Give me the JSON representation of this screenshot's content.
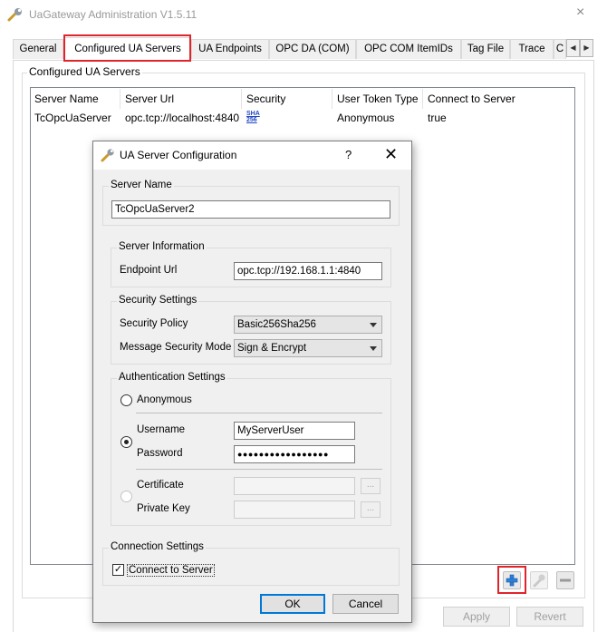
{
  "window": {
    "title": "UaGateway Administration V1.5.11",
    "close_glyph": "×",
    "icon": "wrench-icon"
  },
  "tabs": [
    {
      "label": "General"
    },
    {
      "label": "Configured UA Servers",
      "active": true
    },
    {
      "label": "UA Endpoints"
    },
    {
      "label": "OPC DA (COM)"
    },
    {
      "label": "OPC COM ItemIDs"
    },
    {
      "label": "Tag File"
    },
    {
      "label": "Trace"
    },
    {
      "label": "C"
    }
  ],
  "tab_scroll": {
    "left": "◀",
    "right": "▶"
  },
  "servers_panel": {
    "title": "Configured UA Servers",
    "columns": [
      "Server Name",
      "Server Url",
      "Security",
      "User Token Type",
      "Connect to Server"
    ],
    "rows": [
      {
        "server_name": "TcOpcUaServer",
        "server_url": "opc.tcp://localhost:4840",
        "security_icon_text": "SHA 256",
        "user_token_type": "Anonymous",
        "connect": "true"
      }
    ],
    "toolbar": {
      "add": "add-icon",
      "edit": "wrench-icon",
      "remove": "remove-icon"
    }
  },
  "footer": {
    "apply": "Apply",
    "revert": "Revert"
  },
  "dialog": {
    "title": "UA Server Configuration",
    "help": "?",
    "close": "✕",
    "server_name_group": "Server Name",
    "server_name_value": "TcOpcUaServer2",
    "server_info_group": "Server Information",
    "endpoint_url_label": "Endpoint Url",
    "endpoint_url_value": "opc.tcp://192.168.1.1:4840",
    "security_group": "Security Settings",
    "security_policy_label": "Security Policy",
    "security_policy_value": "Basic256Sha256",
    "message_mode_label": "Message Security Mode",
    "message_mode_value": "Sign & Encrypt",
    "auth_group": "Authentication Settings",
    "anonymous_label": "Anonymous",
    "username_label": "Username",
    "username_value": "MyServerUser",
    "password_label": "Password",
    "password_value": "●●●●●●●●●●●●●●●●●",
    "certificate_label": "Certificate",
    "private_key_label": "Private Key",
    "browse": "...",
    "connection_group": "Connection Settings",
    "connect_label": "Connect to Server",
    "connect_checked": true,
    "ok": "OK",
    "cancel": "Cancel"
  },
  "colors": {
    "highlight": "#e0242b",
    "accent": "#2f7fd8"
  }
}
